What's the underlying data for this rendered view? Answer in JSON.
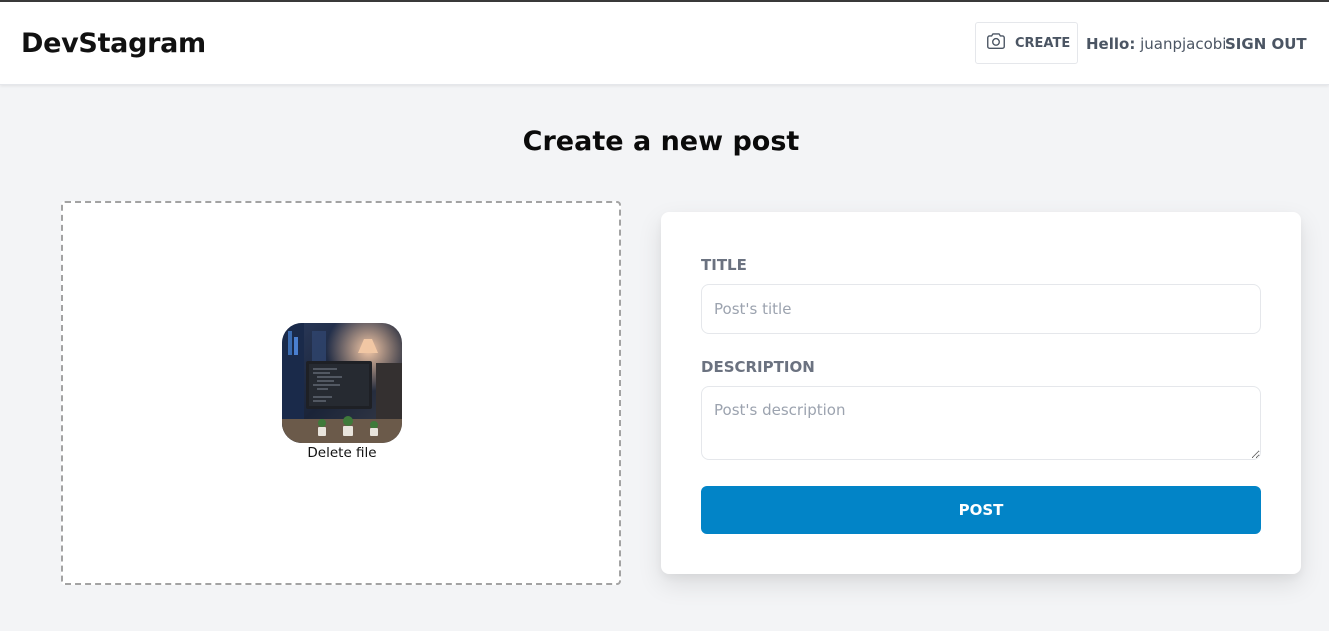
{
  "header": {
    "brand": "DevStagram",
    "create_label": "CREATE",
    "hello_prefix": "Hello:",
    "username": "juanpjacobi",
    "signout_label": "SIGN OUT"
  },
  "page": {
    "title": "Create a new post"
  },
  "dropzone": {
    "delete_label": "Delete file",
    "thumbnail_icon": "uploaded-image-thumbnail"
  },
  "form": {
    "title_label": "Title",
    "title_placeholder": "Post's title",
    "title_value": "",
    "description_label": "Description",
    "description_placeholder": "Post's description",
    "description_value": "",
    "submit_label": "POST"
  },
  "colors": {
    "primary": "#0284c7",
    "background": "#f3f4f6",
    "label": "#6b7280"
  }
}
